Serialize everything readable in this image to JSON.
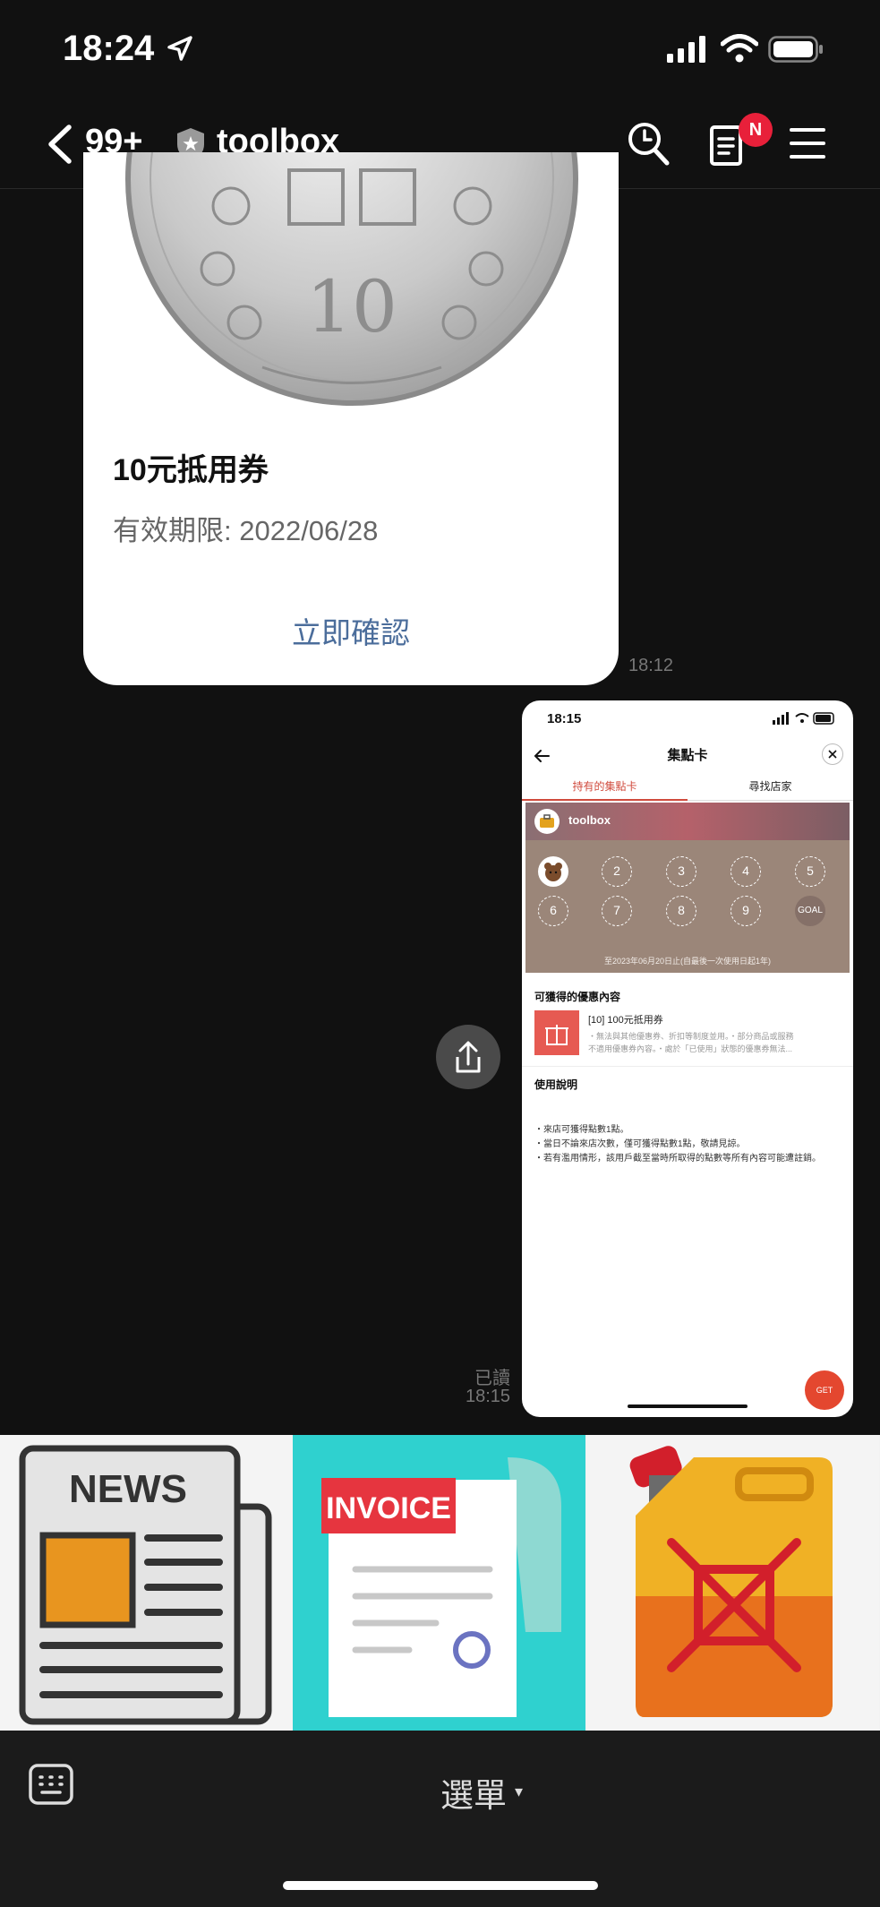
{
  "status_bar": {
    "time": "18:24"
  },
  "header": {
    "back_count": "99+",
    "title": "toolbox",
    "notes_badge": "N"
  },
  "coupon": {
    "title": "10元抵用券",
    "expiry": "有效期限: 2022/06/28",
    "confirm_label": "立即確認",
    "time": "18:12"
  },
  "screenshot": {
    "time": "18:15",
    "title": "集點卡",
    "tabs": [
      "持有的集點卡",
      "尋找店家"
    ],
    "brand": "toolbox",
    "stamps": [
      "2",
      "3",
      "4",
      "5",
      "6",
      "7",
      "8",
      "9",
      "GOAL"
    ],
    "card_note": "至2023年06月20日止(自最後一次使用日起1年)",
    "offers_heading": "可獲得的優惠內容",
    "offer_title": "[10] 100元抵用券",
    "offer_desc_1": "・無法與其他優惠券、折扣等制度並用。・部分商品或服務",
    "offer_desc_2": "不適用優惠券內容。・處於「已使用」狀態的優惠券無法...",
    "usage_heading": "使用說明",
    "instructions": [
      "・來店可獲得點數1點。",
      "・當日不論來店次數，僅可獲得點數1點，敬請見諒。",
      "・若有濫用情形，該用戶截至當時所取得的點數等所有內容可能遭註銷。"
    ],
    "fab_label": "GET"
  },
  "sent_status": {
    "read": "已讀",
    "time": "18:15"
  },
  "rich_menu": {
    "news_label": "NEWS",
    "invoice_label": "INVOICE"
  },
  "bottom_bar": {
    "menu_label": "選單",
    "menu_arrow": "▾"
  }
}
